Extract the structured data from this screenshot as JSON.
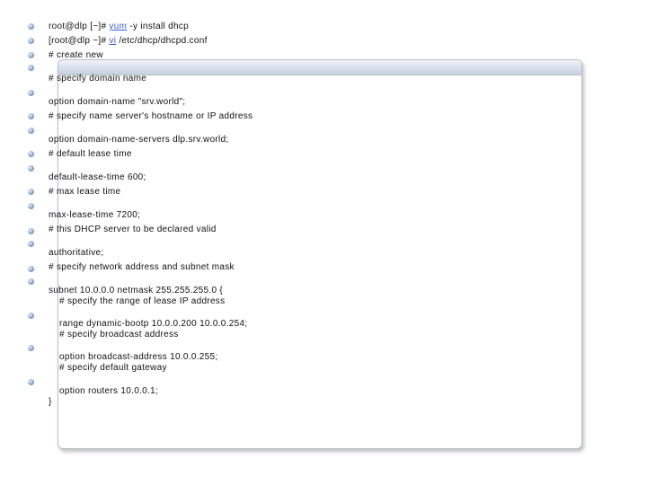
{
  "lines": {
    "l1_prefix": "root@dlp [~]# ",
    "l1_cmd": "yum",
    "l1_suffix": " -y install dhcp",
    "l2_prefix": "[root@dlp ~]# ",
    "l2_cmd": "vi",
    "l2_suffix": " /etc/dhcp/dhcpd.conf",
    "l3": "# create new",
    "l4": "# specify domain name",
    "l5": "option domain-name \"srv.world\";",
    "l6": "# specify name server's hostname or IP address",
    "l7": "option domain-name-servers dlp.srv.world;",
    "l8": "# default lease time",
    "l9": "default-lease-time 600;",
    "l10": "# max lease time",
    "l11": "max-lease-time 7200;",
    "l12": "# this DHCP server to be declared valid",
    "l13": "authoritative;",
    "l14": "# specify network address and subnet mask",
    "l15": "subnet 10.0.0.0 netmask 255.255.255.0 {",
    "l16": "# specify the range of lease IP address",
    "l17": "range dynamic-bootp 10.0.0.200 10.0.0.254;",
    "l18": "# specify broadcast address",
    "l19": "option broadcast-address 10.0.0.255;",
    "l20": "# specify default gateway",
    "l21": "option routers 10.0.0.1;",
    "l22": "}"
  }
}
